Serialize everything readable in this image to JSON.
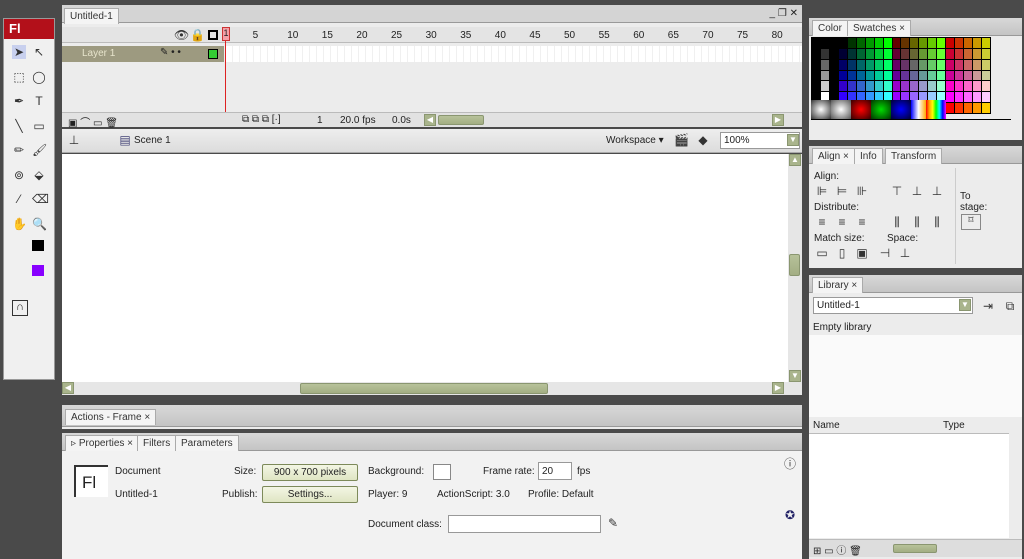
{
  "toolbar": {
    "logo": "Fl",
    "tools": [
      "selection-tool",
      "subselection-tool",
      "free-transform-tool",
      "lasso-tool",
      "pen-tool",
      "text-tool",
      "line-tool",
      "rectangle-tool",
      "pencil-tool",
      "brush-tool",
      "ink-bottle-tool",
      "paint-bucket-tool",
      "eyedropper-tool",
      "eraser-tool",
      "hand-tool",
      "zoom-tool"
    ],
    "stroke_color": "#000000",
    "fill_color": "#8800ff"
  },
  "timeline": {
    "doc_tab": "Untitled-1",
    "frame_numbers": [
      "1",
      "5",
      "10",
      "15",
      "20",
      "25",
      "30",
      "35",
      "40",
      "45",
      "50",
      "55",
      "60",
      "65",
      "70",
      "75",
      "80"
    ],
    "layer_name": "Layer 1",
    "current_frame": "1",
    "fps": "20.0 fps",
    "time": "0.0s"
  },
  "editbar": {
    "scene": "Scene 1",
    "workspace": "Workspace",
    "zoom": "100%"
  },
  "actions": {
    "tab": "Actions - Frame"
  },
  "properties": {
    "tabs": [
      "Properties",
      "Filters",
      "Parameters"
    ],
    "doc_label": "Document",
    "doc_name": "Untitled-1",
    "size_label": "Size:",
    "size_value": "900 x 700 pixels",
    "publish_label": "Publish:",
    "settings_button": "Settings...",
    "background_label": "Background:",
    "background_color": "#ffffff",
    "frame_rate_label": "Frame rate:",
    "frame_rate": "20",
    "fps_unit": "fps",
    "player": "Player:  9",
    "actionscript": "ActionScript:  3.0",
    "profile": "Profile:  Default",
    "doc_class_label": "Document class:",
    "doc_class_value": ""
  },
  "swatches": {
    "tabs": [
      "Color",
      "Swatches"
    ]
  },
  "align": {
    "tabs": [
      "Align",
      "Info",
      "Transform"
    ],
    "align_label": "Align:",
    "distribute_label": "Distribute:",
    "match_label": "Match size:",
    "space_label": "Space:",
    "to_stage": "To stage:"
  },
  "library": {
    "tab": "Library",
    "document": "Untitled-1",
    "status": "Empty library",
    "col_name": "Name",
    "col_type": "Type"
  }
}
